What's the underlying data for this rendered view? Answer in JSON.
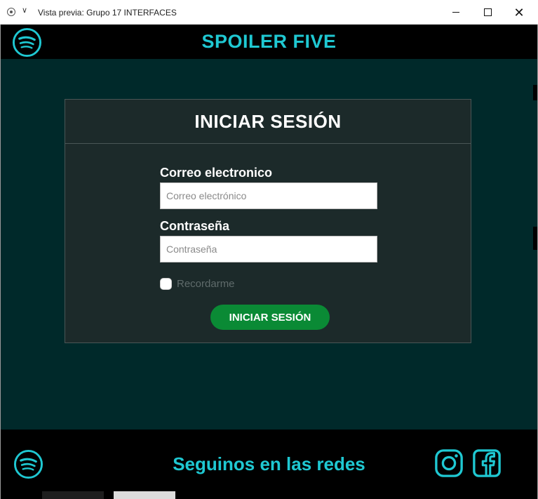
{
  "window": {
    "title": "Vista previa: Grupo 17 INTERFACES",
    "minimize_glyph": "",
    "maximize_glyph": "",
    "close_glyph": "✕"
  },
  "header": {
    "title": "SPOILER FIVE"
  },
  "login": {
    "title": "INICIAR SESIÓN",
    "email_label": "Correo electronico",
    "email_placeholder": "Correo electrónico",
    "email_value": "",
    "password_label": "Contraseña",
    "password_placeholder": "Contraseña",
    "password_value": "",
    "remember_label": "Recordarme",
    "remember_checked": false,
    "submit_label": "INICIAR SESIÓN"
  },
  "footer": {
    "text": "Seguinos en las redes",
    "icons": [
      "spotify-icon",
      "instagram-icon",
      "facebook-icon"
    ]
  },
  "colors": {
    "accent": "#1fc8d2",
    "background": "#00292a",
    "card": "#1c2a2a",
    "button": "#0a8a35",
    "bar": "#000000"
  }
}
